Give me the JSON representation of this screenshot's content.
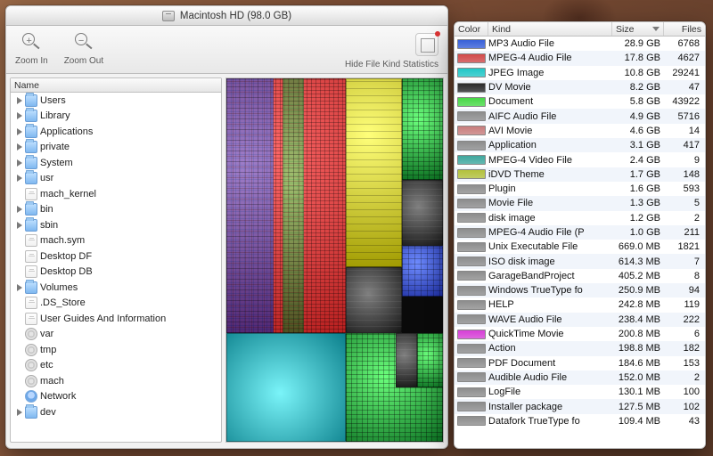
{
  "title": "Macintosh HD (98.0 GB)",
  "toolbar": {
    "zoom_in": "Zoom In",
    "zoom_out": "Zoom Out",
    "hide_stats": "Hide File Kind Statistics"
  },
  "tree_header": "Name",
  "tree": [
    {
      "name": "Users",
      "kind": "folder",
      "tri": true,
      "indent": 0
    },
    {
      "name": "Library",
      "kind": "folder",
      "tri": true,
      "indent": 0
    },
    {
      "name": "Applications",
      "kind": "folder",
      "tri": true,
      "indent": 0
    },
    {
      "name": "private",
      "kind": "folder",
      "tri": true,
      "indent": 0
    },
    {
      "name": "System",
      "kind": "folder",
      "tri": true,
      "indent": 0
    },
    {
      "name": "usr",
      "kind": "folder",
      "tri": true,
      "indent": 0
    },
    {
      "name": "mach_kernel",
      "kind": "file",
      "tri": false,
      "indent": 0
    },
    {
      "name": "bin",
      "kind": "folder",
      "tri": true,
      "indent": 0
    },
    {
      "name": "sbin",
      "kind": "folder",
      "tri": true,
      "indent": 0
    },
    {
      "name": "mach.sym",
      "kind": "file",
      "tri": false,
      "indent": 0
    },
    {
      "name": "Desktop DF",
      "kind": "file",
      "tri": false,
      "indent": 0
    },
    {
      "name": "Desktop DB",
      "kind": "file",
      "tri": false,
      "indent": 0
    },
    {
      "name": "Volumes",
      "kind": "folder",
      "tri": true,
      "indent": 0
    },
    {
      "name": ".DS_Store",
      "kind": "file",
      "tri": false,
      "indent": 0
    },
    {
      "name": "User Guides And Information",
      "kind": "file",
      "tri": false,
      "indent": 0
    },
    {
      "name": "var",
      "kind": "cog",
      "tri": false,
      "indent": 0
    },
    {
      "name": "tmp",
      "kind": "cog",
      "tri": false,
      "indent": 0
    },
    {
      "name": "etc",
      "kind": "cog",
      "tri": false,
      "indent": 0
    },
    {
      "name": "mach",
      "kind": "cog",
      "tri": false,
      "indent": 0
    },
    {
      "name": "Network",
      "kind": "net",
      "tri": false,
      "indent": 0
    },
    {
      "name": "dev",
      "kind": "folder",
      "tri": true,
      "indent": 0
    }
  ],
  "stats_header": {
    "color": "Color",
    "kind": "Kind",
    "size": "Size",
    "files": "Files"
  },
  "stats": [
    {
      "kind": "MP3 Audio File",
      "size": "28.9 GB",
      "files": "6768",
      "color": "#3860d8"
    },
    {
      "kind": "MPEG-4 Audio File",
      "size": "17.8 GB",
      "files": "4627",
      "color": "#d24a4a"
    },
    {
      "kind": "JPEG Image",
      "size": "10.8 GB",
      "files": "29241",
      "color": "#22c6c6"
    },
    {
      "kind": "DV Movie",
      "size": "8.2 GB",
      "files": "47",
      "color": "#2a2a2a"
    },
    {
      "kind": "Document",
      "size": "5.8 GB",
      "files": "43922",
      "color": "#47d847"
    },
    {
      "kind": "AIFC Audio File",
      "size": "4.9 GB",
      "files": "5716",
      "color": "#8d8d8d"
    },
    {
      "kind": "AVI Movie",
      "size": "4.6 GB",
      "files": "14",
      "color": "#c77d7d"
    },
    {
      "kind": "Application",
      "size": "3.1 GB",
      "files": "417",
      "color": "#8d8d8d"
    },
    {
      "kind": "MPEG-4 Video File",
      "size": "2.4 GB",
      "files": "9",
      "color": "#3fa79e"
    },
    {
      "kind": "iDVD Theme",
      "size": "1.7 GB",
      "files": "148",
      "color": "#b3c13c"
    },
    {
      "kind": "Plugin",
      "size": "1.6 GB",
      "files": "593",
      "color": "#8d8d8d"
    },
    {
      "kind": "Movie File",
      "size": "1.3 GB",
      "files": "5",
      "color": "#8d8d8d"
    },
    {
      "kind": "disk image",
      "size": "1.2 GB",
      "files": "2",
      "color": "#8d8d8d"
    },
    {
      "kind": "MPEG-4 Audio File (P",
      "size": "1.0 GB",
      "files": "211",
      "color": "#8d8d8d"
    },
    {
      "kind": "Unix Executable File",
      "size": "669.0 MB",
      "files": "1821",
      "color": "#8d8d8d"
    },
    {
      "kind": "ISO disk image",
      "size": "614.3 MB",
      "files": "7",
      "color": "#8d8d8d"
    },
    {
      "kind": "GarageBandProject",
      "size": "405.2 MB",
      "files": "8",
      "color": "#8d8d8d"
    },
    {
      "kind": "Windows TrueType fo",
      "size": "250.9 MB",
      "files": "94",
      "color": "#8d8d8d"
    },
    {
      "kind": "HELP",
      "size": "242.8 MB",
      "files": "119",
      "color": "#8d8d8d"
    },
    {
      "kind": "WAVE Audio File",
      "size": "238.4 MB",
      "files": "222",
      "color": "#8d8d8d"
    },
    {
      "kind": "QuickTime Movie",
      "size": "200.8 MB",
      "files": "6",
      "color": "#d63fd6"
    },
    {
      "kind": "Action",
      "size": "198.8 MB",
      "files": "182",
      "color": "#8d8d8d"
    },
    {
      "kind": "PDF Document",
      "size": "184.6 MB",
      "files": "153",
      "color": "#8d8d8d"
    },
    {
      "kind": "Audible Audio File",
      "size": "152.0 MB",
      "files": "2",
      "color": "#8d8d8d"
    },
    {
      "kind": "LogFile",
      "size": "130.1 MB",
      "files": "100",
      "color": "#8d8d8d"
    },
    {
      "kind": "Installer package",
      "size": "127.5 MB",
      "files": "102",
      "color": "#8d8d8d"
    },
    {
      "kind": "Datafork TrueType fo",
      "size": "109.4 MB",
      "files": "43",
      "color": "#8d8d8d"
    }
  ]
}
